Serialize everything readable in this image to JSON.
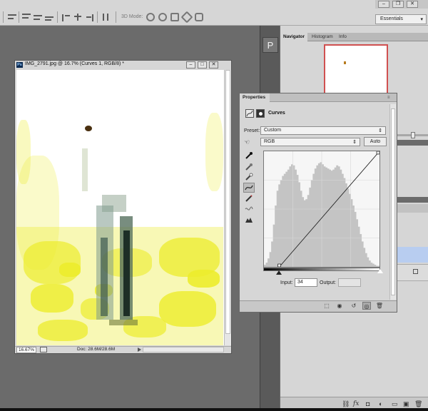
{
  "workspace": {
    "selected": "Essentials"
  },
  "options_bar": {
    "mode_3d_label": "3D Mode:"
  },
  "dock": {
    "tabs": [
      "Navigator",
      "Histogram",
      "Info"
    ],
    "panel_button": "P"
  },
  "document": {
    "ps_badge": "Ps",
    "title": "IMG_2791.jpg @ 16.7% (Curves 1, RGB/8) *",
    "zoom": "16.67%",
    "doc_info": "Doc: 28.6M/28.6M"
  },
  "properties": {
    "tab_label": "Properties",
    "adjustment_label": "Curves",
    "preset_label": "Preset:",
    "preset_value": "Custom",
    "channel_value": "RGB",
    "auto_label": "Auto",
    "input_label": "Input:",
    "input_value": "34",
    "output_label": "Output:",
    "output_value": ""
  },
  "curve": {
    "input_min": 0,
    "input_max": 255,
    "black_point_input": 34,
    "white_point_input": 255,
    "histogram_levels": [
      2,
      4,
      8,
      14,
      24,
      40,
      58,
      72,
      78,
      82,
      86,
      88,
      90,
      92,
      95,
      97,
      96,
      92,
      87,
      80,
      72,
      66,
      63,
      64,
      68,
      75,
      82,
      88,
      93,
      96,
      98,
      99,
      97,
      95,
      94,
      93,
      92,
      91,
      92,
      94,
      96,
      95,
      92,
      88,
      84,
      79,
      74,
      69,
      64,
      58,
      52,
      45,
      38,
      31,
      24,
      18,
      13,
      9,
      6,
      4,
      3,
      2,
      1,
      1
    ]
  },
  "colors": {
    "highlight_yellow": "#ecec2c",
    "selected_layer": "#b8cdf0",
    "navigator_frame": "#d05050"
  }
}
